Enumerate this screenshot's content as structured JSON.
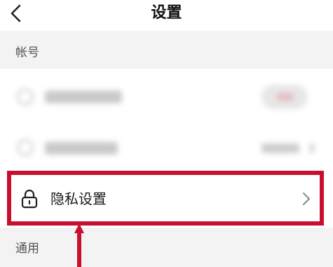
{
  "header": {
    "back_icon": "chevron-left-icon",
    "title": "设置"
  },
  "sections": {
    "account_header": "帐号",
    "general_header": "通用"
  },
  "privacy_item": {
    "icon": "lock-icon",
    "label": "隐私设置",
    "chevron_icon": "chevron-right-icon"
  },
  "colors": {
    "highlight": "#c8102e",
    "background": "#f4f4f4",
    "card": "#ffffff"
  }
}
